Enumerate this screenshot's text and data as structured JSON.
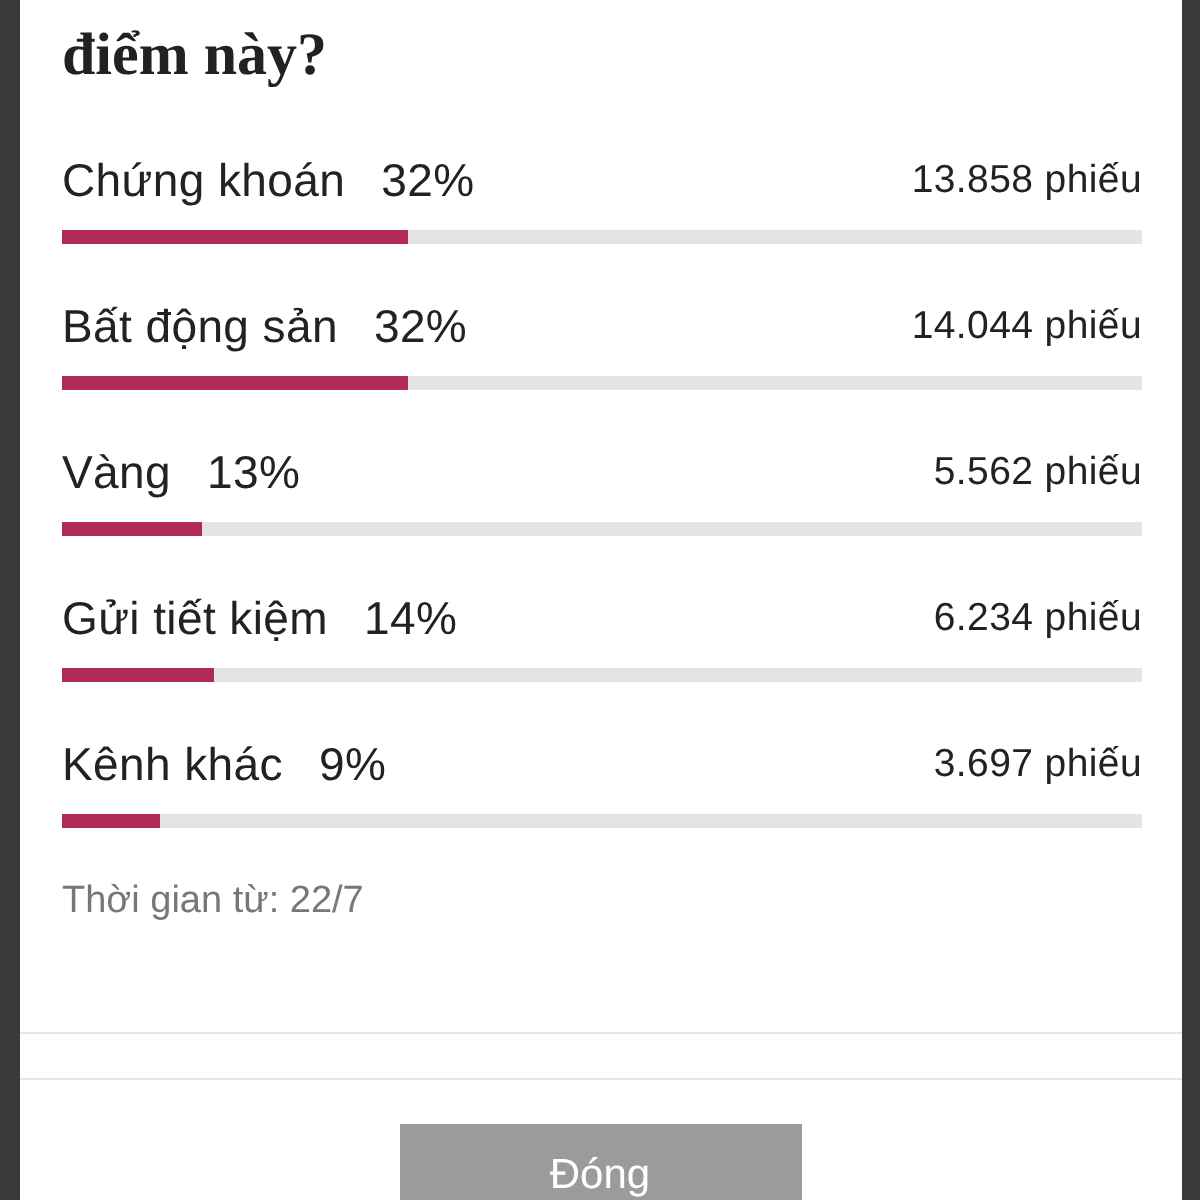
{
  "question": "điểm này?",
  "options": [
    {
      "label": "Chứng khoán",
      "percent": "32%",
      "votes": "13.858 phiếu",
      "level": 0.32
    },
    {
      "label": "Bất động sản",
      "percent": "32%",
      "votes": "14.044 phiếu",
      "level": 0.32
    },
    {
      "label": "Vàng",
      "percent": "13%",
      "votes": "5.562 phiếu",
      "level": 0.13
    },
    {
      "label": "Gửi tiết kiệm",
      "percent": "14%",
      "votes": "6.234 phiếu",
      "level": 0.14
    },
    {
      "label": "Kênh khác",
      "percent": "9%",
      "votes": "3.697 phiếu",
      "level": 0.09
    }
  ],
  "time_note": "Thời gian từ: 22/7",
  "buttons": [
    {
      "label": "Đóng"
    }
  ]
}
